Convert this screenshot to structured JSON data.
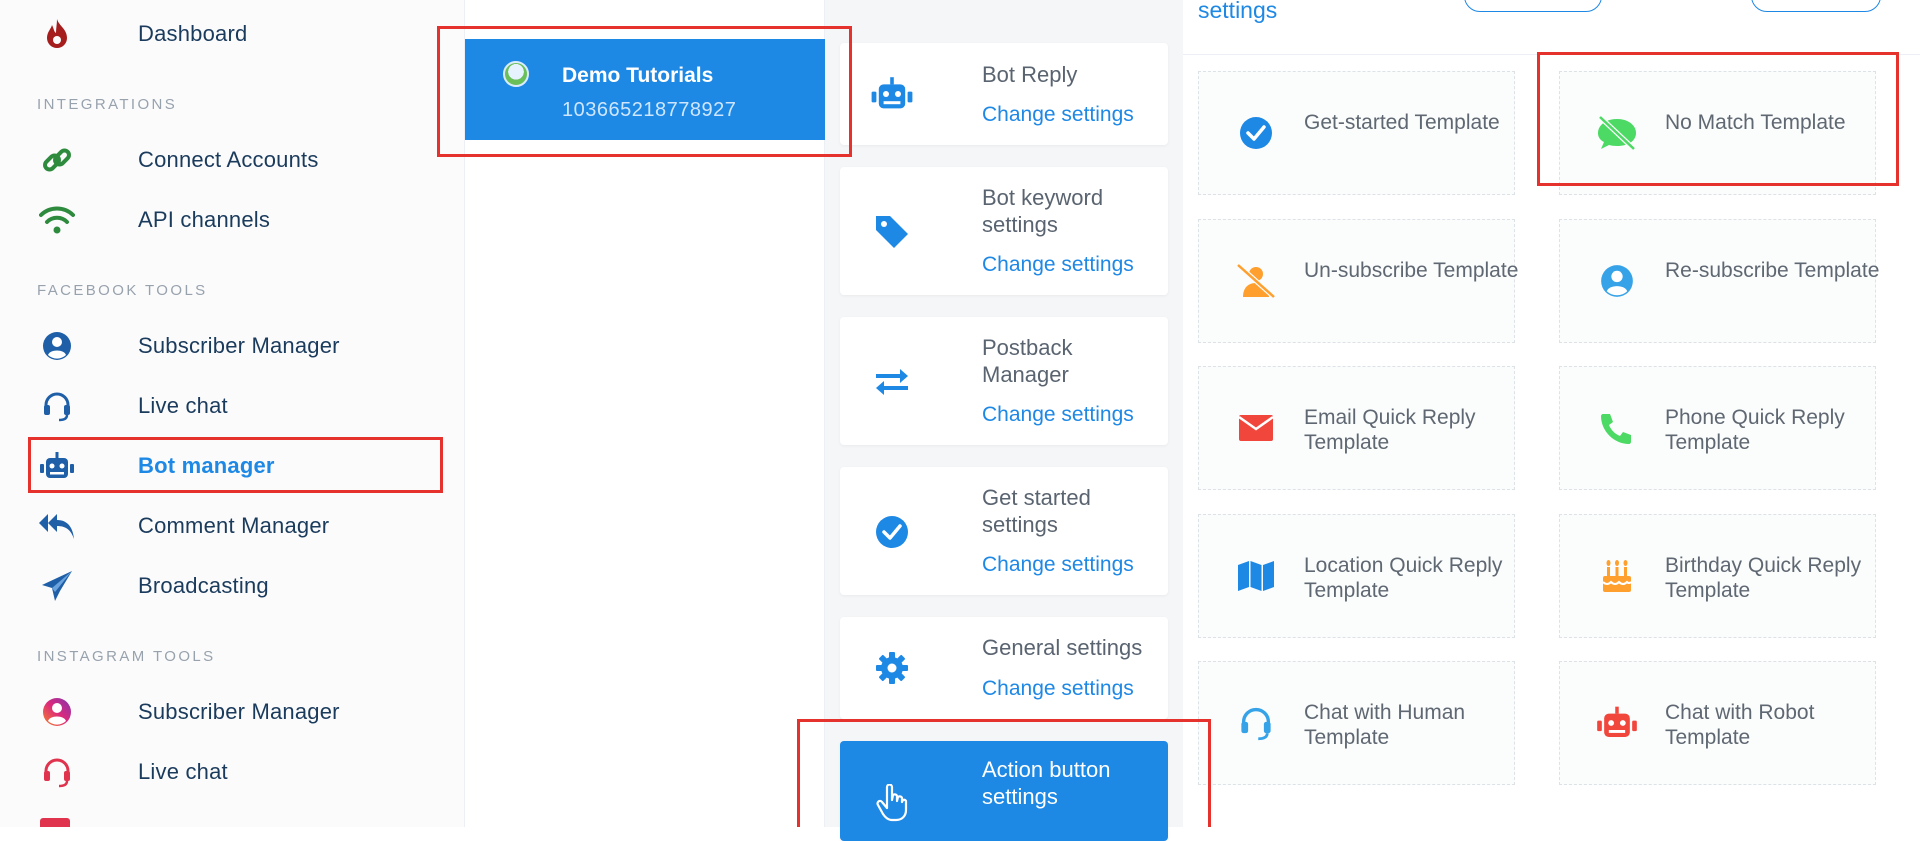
{
  "sidebar": {
    "items": [
      {
        "label": "Dashboard",
        "icon": "fire-icon"
      },
      {
        "label": "Connect Accounts",
        "icon": "link-icon"
      },
      {
        "label": "API channels",
        "icon": "wifi-icon"
      },
      {
        "label": "Subscriber Manager",
        "icon": "user-circle-icon"
      },
      {
        "label": "Live chat",
        "icon": "headset-icon"
      },
      {
        "label": "Bot manager",
        "icon": "robot-icon"
      },
      {
        "label": "Comment Manager",
        "icon": "reply-all-icon"
      },
      {
        "label": "Broadcasting",
        "icon": "paper-plane-icon"
      },
      {
        "label": "Subscriber Manager",
        "icon": "user-circle-icon"
      },
      {
        "label": "Live chat",
        "icon": "headset-icon"
      }
    ],
    "sections": {
      "integrations": "INTEGRATIONS",
      "facebook": "FACEBOOK TOOLS",
      "instagram": "INSTAGRAM TOOLS"
    },
    "active_color": "#1e88e5"
  },
  "page": {
    "name": "Demo Tutorials",
    "id": "103665218778927"
  },
  "settings": {
    "change_label": "Change settings",
    "cards": [
      {
        "title": "Bot Reply",
        "icon": "robot-icon"
      },
      {
        "title": "Bot keyword settings",
        "icon": "tag-icon"
      },
      {
        "title": "Postback Manager",
        "icon": "exchange-icon"
      },
      {
        "title": "Get started settings",
        "icon": "check-circle-icon"
      },
      {
        "title": "General settings",
        "icon": "gear-icon"
      },
      {
        "title": "Action button settings",
        "icon": "hand-pointer-icon"
      }
    ]
  },
  "templates": {
    "header_title": "settings",
    "items": [
      {
        "label": "Get-started Template",
        "icon": "check-circle-icon",
        "color": "#1e88e5"
      },
      {
        "label": "No Match Template",
        "icon": "comment-slash-icon",
        "color": "#4cd964"
      },
      {
        "label": "Un-subscribe Template",
        "icon": "user-slash-icon",
        "color": "#ff9f2e"
      },
      {
        "label": "Re-subscribe Template",
        "icon": "user-circle-icon",
        "color": "#36a3e8"
      },
      {
        "label": "Email Quick Reply Template",
        "icon": "envelope-icon",
        "color": "#f0463c"
      },
      {
        "label": "Phone Quick Reply Template",
        "icon": "phone-icon",
        "color": "#4cd964"
      },
      {
        "label": "Location Quick Reply Template",
        "icon": "map-icon",
        "color": "#1e88e5"
      },
      {
        "label": "Birthday Quick Reply Template",
        "icon": "birthday-cake-icon",
        "color": "#ff9f2e"
      },
      {
        "label": "Chat with Human Template",
        "icon": "headset-icon",
        "color": "#36a3e8"
      },
      {
        "label": "Chat with Robot Template",
        "icon": "robot-icon",
        "color": "#f0463c"
      }
    ]
  }
}
